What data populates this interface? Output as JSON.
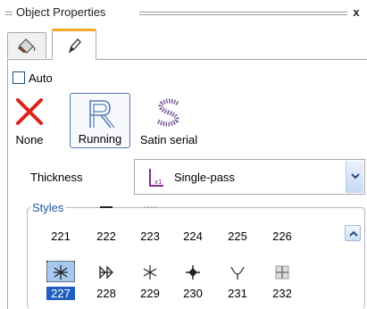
{
  "panel": {
    "title": "Object Properties",
    "close_label": "x"
  },
  "tabs": [
    {
      "icon": "paint-bucket-icon"
    },
    {
      "icon": "pen-icon",
      "active": true
    }
  ],
  "auto": {
    "label": "Auto",
    "checked": false
  },
  "stitch_types": [
    {
      "label": "None",
      "icon": "red-x-icon"
    },
    {
      "label": "Running",
      "icon": "running-r-icon",
      "selected": true
    },
    {
      "label": "Satin serial",
      "icon": "satin-s-icon"
    }
  ],
  "thickness": {
    "label": "Thickness",
    "value": "Single-pass",
    "icon": "single-pass-icon"
  },
  "styles": {
    "legend": "Styles",
    "row1": [
      "221",
      "222",
      "223",
      "224",
      "225",
      "226"
    ],
    "row2": [
      "227",
      "228",
      "229",
      "230",
      "231",
      "232"
    ],
    "selected": "227"
  },
  "colors": {
    "accent_tab": "#f5a623",
    "selection": "#1e5fc0",
    "legend": "#1a57a8",
    "none_x": "#e0201a",
    "thickness_icon": "#8a2a9a"
  }
}
